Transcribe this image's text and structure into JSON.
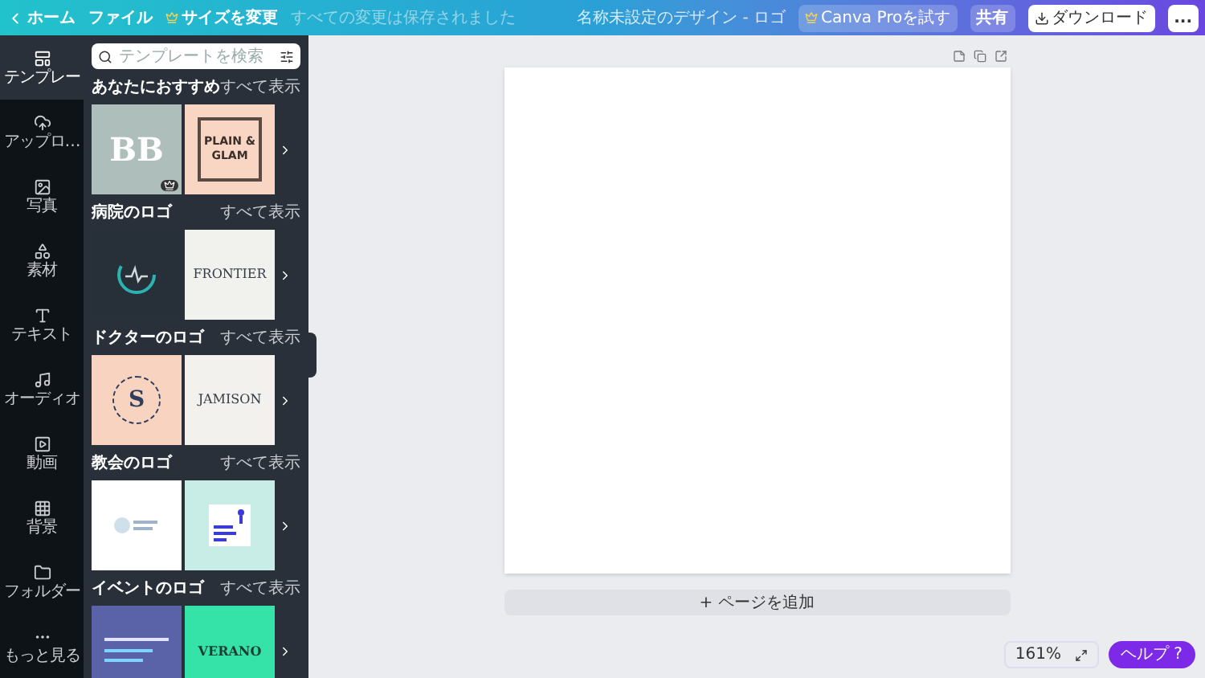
{
  "topbar": {
    "home": "ホーム",
    "file": "ファイル",
    "resize": "サイズを変更",
    "save_status": "すべての変更は保存されました",
    "design_title": "名称未設定のデザイン - ロゴ",
    "pro": "Canva Proを試す",
    "share": "共有",
    "download": "ダウンロード",
    "more": "..."
  },
  "rail": [
    {
      "label": "テンプレー",
      "selected": true
    },
    {
      "label": "アップロ…",
      "selected": false
    },
    {
      "label": "写真",
      "selected": false
    },
    {
      "label": "素材",
      "selected": false
    },
    {
      "label": "テキスト",
      "selected": false
    },
    {
      "label": "オーディオ",
      "selected": false
    },
    {
      "label": "動画",
      "selected": false
    },
    {
      "label": "背景",
      "selected": false
    },
    {
      "label": "フォルダー",
      "selected": false
    },
    {
      "label": "もっと見る",
      "selected": false
    }
  ],
  "search": {
    "placeholder": "テンプレートを検索"
  },
  "sections": [
    {
      "title": "あなたにおすすめ",
      "see_all": "すべて表示",
      "thumbnails": [
        {
          "color": "#aebfbb",
          "text": "BB",
          "kind": "big"
        },
        {
          "color": "#f9d5c3",
          "text": "PLAIN & GLAM",
          "kind": "frame"
        }
      ]
    },
    {
      "title": "病院のロゴ",
      "see_all": "すべて表示",
      "thumbnails": [
        {
          "color": "#273038",
          "kind": "pulse"
        },
        {
          "color": "#f1f1ee",
          "text": "FRONTIER",
          "kind": "word"
        }
      ]
    },
    {
      "title": "ドクターのロゴ",
      "see_all": "すべて表示",
      "thumbnails": [
        {
          "color": "#f7d3c0",
          "text": "S",
          "kind": "seal"
        },
        {
          "color": "#f2f1ee",
          "text": "JAMISON",
          "kind": "word"
        }
      ]
    },
    {
      "title": "教会のロゴ",
      "see_all": "すべて表示",
      "thumbnails": [
        {
          "color": "#ffffff",
          "kind": "dove"
        },
        {
          "color": "#c8ece6",
          "kind": "card"
        }
      ]
    },
    {
      "title": "イベントのロゴ",
      "see_all": "すべて表示",
      "thumbnails": [
        {
          "color": "#5a62a8",
          "kind": "lines"
        },
        {
          "color": "#35e2a8",
          "text": "VERANO",
          "kind": "word"
        }
      ]
    }
  ],
  "canvas": {
    "add_page": "+ ページを追加"
  },
  "zoom": {
    "value": "161%"
  },
  "help": "ヘルプ ?"
}
